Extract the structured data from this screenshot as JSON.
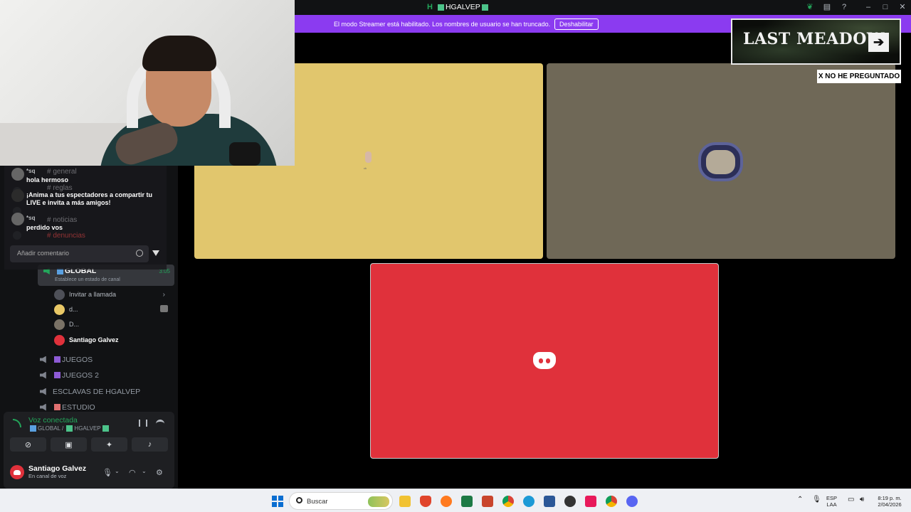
{
  "window": {
    "title_logo": "H",
    "title": "HGALVEP"
  },
  "streamer_bar": {
    "message": "El modo Streamer está habilitado. Los nombres de usuario se han truncado.",
    "disable_button": "Deshabilitar"
  },
  "overlay_chat": {
    "messages": [
      {
        "user": "*sq",
        "text": "hola hermoso"
      },
      {
        "user": "",
        "text": "¡Anima a tus espectadores a compartir tu LIVE e invita a más amigos!"
      },
      {
        "user": "*sq",
        "text": "perdido vos"
      }
    ],
    "ghost_channels": [
      "general",
      "reglas",
      "noticias",
      "denuncias"
    ],
    "input_placeholder": "Añadir comentario"
  },
  "voice_channels": {
    "active": {
      "name": "GLOBAL",
      "status": "Establece un estado de canal",
      "timer": "3:05"
    },
    "members": [
      {
        "name": "Invitar a llamada",
        "type": "invite"
      },
      {
        "name": "d...",
        "type": "member"
      },
      {
        "name": "D...",
        "type": "member"
      },
      {
        "name": "Santiago Galvez",
        "type": "self"
      }
    ],
    "others": [
      {
        "name": "JUEGOS"
      },
      {
        "name": "JUEGOS 2"
      },
      {
        "name": "ESCLAVAS DE HGALVEP"
      },
      {
        "name": "ESTUDIO"
      }
    ]
  },
  "voice_panel": {
    "status": "Voz conectada",
    "location_global": "GLOBAL",
    "location_sep": "/",
    "location_server": "HGALVEP"
  },
  "user_panel": {
    "name": "Santiago Galvez",
    "status": "En canal de voz"
  },
  "overlays": {
    "banner_text": "LAST MEADOW",
    "label": "X NO HE PREGUNTADO"
  },
  "tiles": {
    "small_label": "ck"
  },
  "taskbar": {
    "search_placeholder": "Buscar",
    "lang_top": "ESP",
    "lang_bottom": "LAA",
    "time": "8:19 p. m.",
    "date": "2/04/2026"
  },
  "colors": {
    "accent_purple": "#8b3bf0",
    "discord_red": "#e0313b",
    "voice_green": "#23a55a",
    "tile_yellow": "#e1c66d",
    "tile_gray": "#6f6857"
  }
}
